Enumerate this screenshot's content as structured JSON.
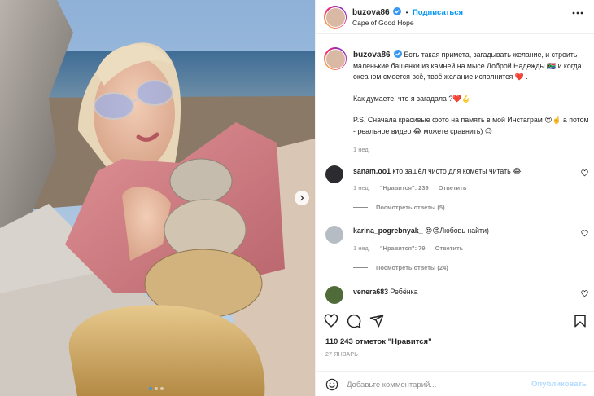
{
  "post": {
    "username": "buzova86",
    "follow_label": "Подписаться",
    "separator": "•",
    "location": "Cape of Good Hope",
    "caption": {
      "p1": "Есть такая примета, загадывать желание, и строить маленькие башенки из камней на мысе Доброй Надежды 🇿🇦 и когда океаном смоется всё, твоё желание исполнится ❤️ .",
      "p2": "Как думаете, что я загадала ?❤️🪝",
      "p3": "P.S. Сначала красивые фото на память в мой Инстаграм 😍☝️ а потом - реальное видео 😂 можете сравнить) 😉",
      "time": "1 нед."
    },
    "comments": [
      {
        "username": "sanam.oo1",
        "text": "кто зашёл чисто для кометы читать 😂",
        "time": "1 нед.",
        "likes": "\"Нравится\": 239",
        "reply": "Ответить",
        "view_replies": "Посмотреть ответы (5)"
      },
      {
        "username": "karina_pogrebnyak_",
        "text": "😍😍Любовь найти)",
        "time": "1 нед.",
        "likes": "\"Нравится\": 79",
        "reply": "Ответить",
        "view_replies": "Посмотреть ответы (24)"
      },
      {
        "username": "venera683",
        "text": "Ребёнка"
      }
    ],
    "likes_text": "110 243 отметок \"Нравится\"",
    "date": "27 ЯНВАРЬ",
    "add_comment_placeholder": "Добавьте комментарий...",
    "publish_label": "Опубликовать"
  },
  "icons": {
    "like": "heart-icon",
    "comment": "comment-icon",
    "share": "paper-plane-icon",
    "save": "bookmark-icon",
    "emoji": "smiley-icon",
    "more": "more-horizontal-icon",
    "verified": "verified-badge-icon",
    "next": "chevron-right-icon"
  },
  "colors": {
    "accent": "#0095f6",
    "verified": "#3897f0",
    "muted": "#8e8e8e",
    "publish_disabled": "#b3dbff"
  },
  "carousel": {
    "total": 3,
    "current": 1
  }
}
